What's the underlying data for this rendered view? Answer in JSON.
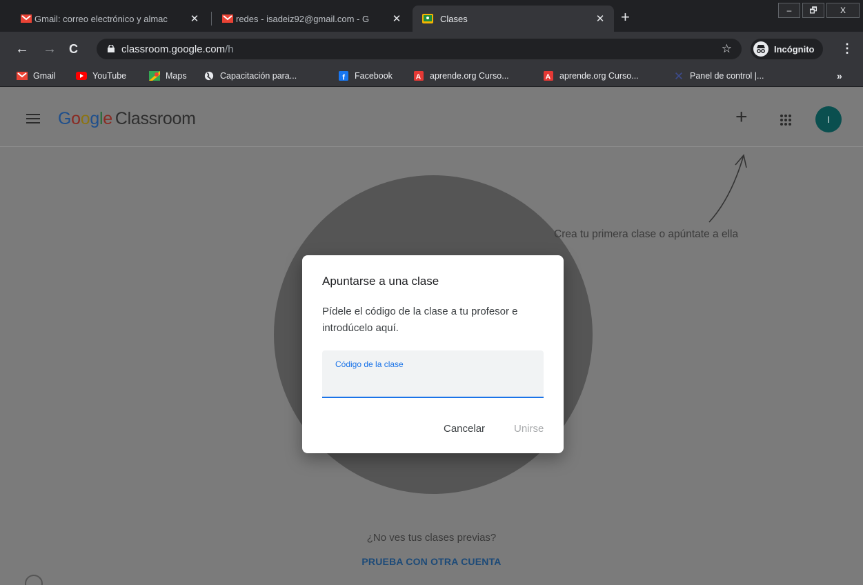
{
  "tabs": [
    {
      "title": "Gmail: correo electrónico y almac",
      "icon": "gmail-icon",
      "active": false
    },
    {
      "title": "redes - isadeiz92@gmail.com - G",
      "icon": "gmail-icon",
      "active": false
    },
    {
      "title": "Clases",
      "icon": "classroom-icon",
      "active": true
    }
  ],
  "window_controls": {
    "minimize": "–",
    "restore": "🗗",
    "close": "X"
  },
  "address_bar": {
    "host": "classroom.google.com",
    "path": "/h"
  },
  "incognito_label": "Incógnito",
  "bookmarks": [
    {
      "label": "Gmail",
      "icon": "gmail-icon"
    },
    {
      "label": "YouTube",
      "icon": "youtube-icon"
    },
    {
      "label": "Maps",
      "icon": "maps-icon"
    },
    {
      "label": "Capacitación para...",
      "icon": "globe-icon"
    },
    {
      "label": "Facebook",
      "icon": "facebook-icon"
    },
    {
      "label": "aprende.org Curso...",
      "icon": "aprende-icon"
    },
    {
      "label": "aprende.org Curso...",
      "icon": "aprende-icon"
    },
    {
      "label": "Panel de control |...",
      "icon": "panel-icon"
    }
  ],
  "app": {
    "logo_google": [
      "G",
      "o",
      "o",
      "g",
      "l",
      "e"
    ],
    "logo_colors": [
      "#1f4f8c",
      "#8a2a22",
      "#8c7412",
      "#1f4f8c",
      "#2a6a38",
      "#8a2a22"
    ],
    "product": "Classroom",
    "avatar_initial": "I",
    "hint": "Crea tu primera clase o apúntate a ella",
    "no_classes_question": "¿No ves tus clases previas?",
    "try_other_account": "PRUEBA CON OTRA CUENTA"
  },
  "dialog": {
    "title": "Apuntarse a una clase",
    "body": "Pídele el código de la clase a tu profesor e introdúcelo aquí.",
    "field_label": "Código de la clase",
    "field_value": "",
    "cancel": "Cancelar",
    "join": "Unirse"
  },
  "colors": {
    "accent": "#1a73e8",
    "avatar": "#0a4f4f"
  }
}
